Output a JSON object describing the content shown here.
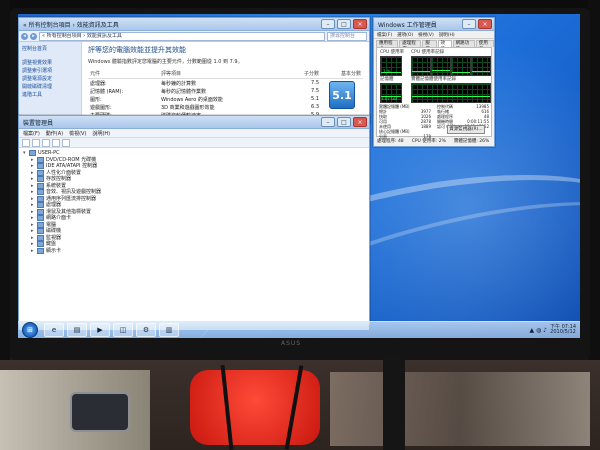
{
  "perf_window": {
    "title": "« 所有控制台項目 › 效能資訊及工具",
    "address": "« 所有控制台項目 › 效能資訊及工具",
    "search_placeholder": "搜尋控制台",
    "heading": "評等您的電腦效能並提升其效能",
    "description": "Windows 體驗指數評定您電腦的主要元件，分數範圍從 1.0 到 7.9。",
    "sidebar": [
      "控制台首頁",
      "調整視覺效果",
      "調整索引選項",
      "調整電源設定",
      "開啟磁碟清理",
      "進階工具"
    ],
    "table": {
      "headers": [
        "元件",
        "評等項目",
        "子分數",
        "基本分數"
      ],
      "rows": [
        {
          "component": "處理器:",
          "item": "每秒鐘的計算數",
          "score": "7.5"
        },
        {
          "component": "記憶體 (RAM):",
          "item": "每秒的記憶體作業數",
          "score": "7.5"
        },
        {
          "component": "圖形:",
          "item": "Windows Aero 的桌面效能",
          "score": "5.1"
        },
        {
          "component": "遊戲圖形:",
          "item": "3D 商業和遊戲圖形效能",
          "score": "6.3"
        },
        {
          "component": "主要硬碟:",
          "item": "磁碟資料傳輸速率",
          "score": "5.9"
        }
      ],
      "base_score": "5.1"
    }
  },
  "devmgr_window": {
    "title": "裝置管理員",
    "menu": [
      "檔案(F)",
      "動作(A)",
      "檢視(V)",
      "說明(H)"
    ],
    "root": "USER-PC",
    "items": [
      "DVD/CD-ROM 光碟機",
      "IDE ATA/ATAPI 控制器",
      "人性化介面裝置",
      "存放控制器",
      "系統裝置",
      "音效、視訊及遊戲控制器",
      "通用序列匯流排控制器",
      "處理器",
      "滑鼠及其他指標裝置",
      "網路介面卡",
      "電腦",
      "磁碟機",
      "監視器",
      "鍵盤",
      "顯示卡"
    ]
  },
  "taskmgr_window": {
    "title": "Windows 工作管理員",
    "menu": [
      "檔案(F)",
      "選項(O)",
      "檢視(V)",
      "說明(H)"
    ],
    "tabs": [
      "應用程式",
      "處理程序",
      "服務",
      "效能",
      "網路功能",
      "使用者"
    ],
    "active_tab": "效能",
    "labels": {
      "cpu": "CPU 使用率",
      "cpu_history": "CPU 使用率記錄",
      "mem": "記憶體",
      "mem_history": "實體記憶體使用率記錄"
    },
    "cpu_value": "2 %",
    "mem_value": "1.07 GB",
    "stats": [
      {
        "label": "實體記憶體 (MB)",
        "value": ""
      },
      {
        "label": "總計",
        "value": "3977"
      },
      {
        "label": "快取",
        "value": "1026"
      },
      {
        "label": "可用",
        "value": "2878"
      },
      {
        "label": "未使用",
        "value": "1889"
      },
      {
        "label": "核心記憶體 (MB)",
        "value": ""
      },
      {
        "label": "分頁",
        "value": "178"
      },
      {
        "label": "未分頁",
        "value": "32"
      }
    ],
    "system_stats": [
      {
        "label": "控制代碼",
        "value": "13985"
      },
      {
        "label": "執行緒",
        "value": "616"
      },
      {
        "label": "處理程序",
        "value": "48"
      },
      {
        "label": "開機時間",
        "value": "0:00:11:55"
      },
      {
        "label": "認可 (MB)",
        "value": "1245 / 7952"
      }
    ],
    "button_label": "資源監視器(R)...",
    "status": {
      "processes": "處理程序: 48",
      "cpu": "CPU 使用率: 2%",
      "memory": "實體記憶體: 26%"
    }
  },
  "taskbar": {
    "start_glyph": "⊞",
    "icons": [
      "ie-icon",
      "explorer-icon",
      "media-player-icon",
      "cpanel-icon",
      "devmgr-icon",
      "taskmgr-icon"
    ],
    "clock_time": "下午 07:14",
    "clock_date": "2010/5/12"
  },
  "monitor_brand": "ASUS"
}
